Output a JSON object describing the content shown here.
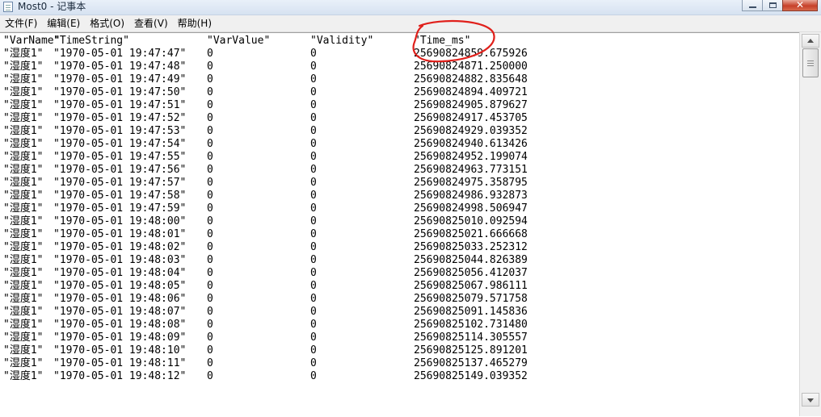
{
  "window": {
    "title": "Most0 - 记事本",
    "minimize_label": "minimize",
    "maximize_label": "maximize",
    "close_glyph": "✕"
  },
  "menu": [
    {
      "label": "文件(F)"
    },
    {
      "label": "编辑(E)"
    },
    {
      "label": "格式(O)"
    },
    {
      "label": "查看(V)"
    },
    {
      "label": "帮助(H)"
    }
  ],
  "content": {
    "header": [
      "\"VarName\"",
      "\"TimeString\"",
      "\"VarValue\"",
      "\"Validity\"",
      "\"Time_ms\""
    ],
    "rows": [
      [
        "\"湿度1\"",
        "\"1970-05-01 19:47:47\"",
        "0",
        "0",
        "25690824859.675926"
      ],
      [
        "\"湿度1\"",
        "\"1970-05-01 19:47:48\"",
        "0",
        "0",
        "25690824871.250000"
      ],
      [
        "\"湿度1\"",
        "\"1970-05-01 19:47:49\"",
        "0",
        "0",
        "25690824882.835648"
      ],
      [
        "\"湿度1\"",
        "\"1970-05-01 19:47:50\"",
        "0",
        "0",
        "25690824894.409721"
      ],
      [
        "\"湿度1\"",
        "\"1970-05-01 19:47:51\"",
        "0",
        "0",
        "25690824905.879627"
      ],
      [
        "\"湿度1\"",
        "\"1970-05-01 19:47:52\"",
        "0",
        "0",
        "25690824917.453705"
      ],
      [
        "\"湿度1\"",
        "\"1970-05-01 19:47:53\"",
        "0",
        "0",
        "25690824929.039352"
      ],
      [
        "\"湿度1\"",
        "\"1970-05-01 19:47:54\"",
        "0",
        "0",
        "25690824940.613426"
      ],
      [
        "\"湿度1\"",
        "\"1970-05-01 19:47:55\"",
        "0",
        "0",
        "25690824952.199074"
      ],
      [
        "\"湿度1\"",
        "\"1970-05-01 19:47:56\"",
        "0",
        "0",
        "25690824963.773151"
      ],
      [
        "\"湿度1\"",
        "\"1970-05-01 19:47:57\"",
        "0",
        "0",
        "25690824975.358795"
      ],
      [
        "\"湿度1\"",
        "\"1970-05-01 19:47:58\"",
        "0",
        "0",
        "25690824986.932873"
      ],
      [
        "\"湿度1\"",
        "\"1970-05-01 19:47:59\"",
        "0",
        "0",
        "25690824998.506947"
      ],
      [
        "\"湿度1\"",
        "\"1970-05-01 19:48:00\"",
        "0",
        "0",
        "25690825010.092594"
      ],
      [
        "\"湿度1\"",
        "\"1970-05-01 19:48:01\"",
        "0",
        "0",
        "25690825021.666668"
      ],
      [
        "\"湿度1\"",
        "\"1970-05-01 19:48:02\"",
        "0",
        "0",
        "25690825033.252312"
      ],
      [
        "\"湿度1\"",
        "\"1970-05-01 19:48:03\"",
        "0",
        "0",
        "25690825044.826389"
      ],
      [
        "\"湿度1\"",
        "\"1970-05-01 19:48:04\"",
        "0",
        "0",
        "25690825056.412037"
      ],
      [
        "\"湿度1\"",
        "\"1970-05-01 19:48:05\"",
        "0",
        "0",
        "25690825067.986111"
      ],
      [
        "\"湿度1\"",
        "\"1970-05-01 19:48:06\"",
        "0",
        "0",
        "25690825079.571758"
      ],
      [
        "\"湿度1\"",
        "\"1970-05-01 19:48:07\"",
        "0",
        "0",
        "25690825091.145836"
      ],
      [
        "\"湿度1\"",
        "\"1970-05-01 19:48:08\"",
        "0",
        "0",
        "25690825102.731480"
      ],
      [
        "\"湿度1\"",
        "\"1970-05-01 19:48:09\"",
        "0",
        "0",
        "25690825114.305557"
      ],
      [
        "\"湿度1\"",
        "\"1970-05-01 19:48:10\"",
        "0",
        "0",
        "25690825125.891201"
      ],
      [
        "\"湿度1\"",
        "\"1970-05-01 19:48:11\"",
        "0",
        "0",
        "25690825137.465279"
      ],
      [
        "\"湿度1\"",
        "\"1970-05-01 19:48:12\"",
        "0",
        "0",
        "25690825149.039352"
      ]
    ]
  },
  "colors": {
    "annotation": "#e0201b",
    "text": "#000000",
    "background": "#ffffff"
  },
  "icons": [
    "notepad-icon",
    "minimize-icon",
    "maximize-icon",
    "close-icon",
    "scroll-up-arrow-icon",
    "scroll-down-arrow-icon"
  ]
}
